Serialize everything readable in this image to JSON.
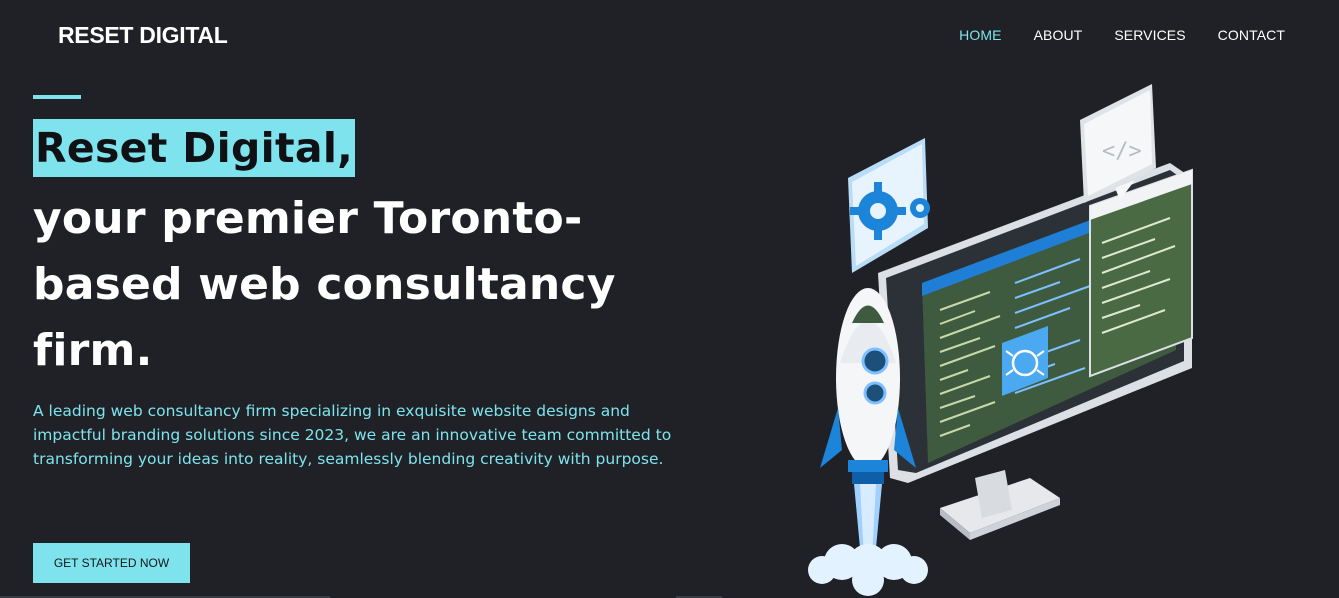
{
  "nav": {
    "logo": "RESET DIGITAL",
    "items": [
      {
        "label": "HOME",
        "active": true
      },
      {
        "label": "ABOUT",
        "active": false
      },
      {
        "label": "SERVICES",
        "active": false
      },
      {
        "label": "CONTACT",
        "active": false
      }
    ]
  },
  "hero": {
    "highlight": "Reset Digital,",
    "headline_lines": [
      "your premier Toronto-",
      "based web consultancy",
      "firm."
    ],
    "description": "A leading web consultancy firm specializing in exquisite website designs and impactful branding solutions since 2023, we are an innovative team committed to transforming your ideas into reality, seamlessly blending creativity with purpose.",
    "cta_label": "GET STARTED NOW"
  },
  "illustration": {
    "icons": [
      "gear-icon",
      "code-icon",
      "bug-icon",
      "rocket-icon"
    ]
  },
  "colors": {
    "background": "#1f2126",
    "accent": "#7ee3ec",
    "text": "#ffffff"
  }
}
